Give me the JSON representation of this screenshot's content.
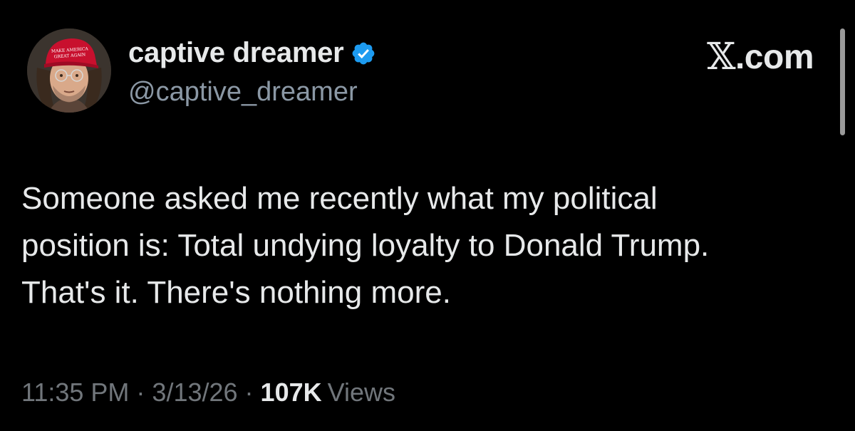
{
  "header": {
    "display_name": "captive dreamer",
    "handle": "@captive_dreamer",
    "verified": true,
    "brand": "X.com",
    "brand_x": "𝕏",
    "brand_rest": ".com",
    "hat_text": "MAKE AMERICA GREAT AGAIN"
  },
  "tweet": {
    "text": "Someone asked me recently what my political\nposition is: Total undying loyalty to Donald Trump.\nThat's it.  There's nothing more."
  },
  "meta": {
    "time": "11:35 PM",
    "separator": "·",
    "date": "3/13/26",
    "views_count": "107K",
    "views_label": "Views"
  },
  "colors": {
    "background": "#000000",
    "primary_text": "#e7e9ea",
    "secondary_text": "#71767b",
    "verified_badge": "#1d9bf0",
    "hat_red": "#c8102e"
  }
}
